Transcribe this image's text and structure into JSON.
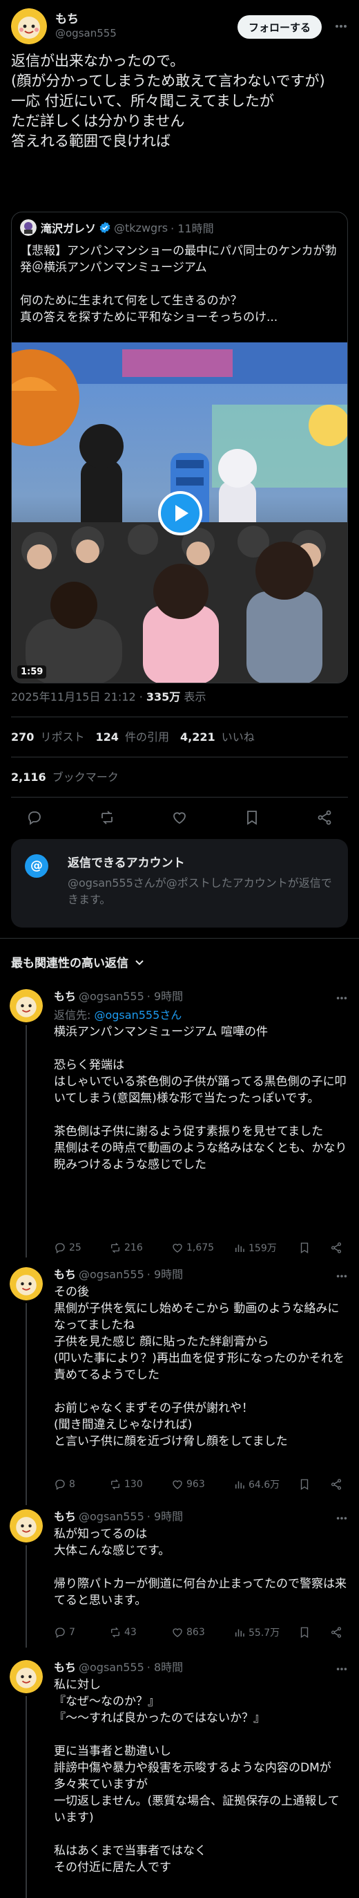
{
  "post": {
    "author_name": "もち",
    "author_handle": "@ogsan555",
    "follow_label": "フォローする",
    "text": "返信が出来なかったので。\n(顔が分かってしまうため敢えて言わないですが)\n一応 付近にいて、所々聞こえてましたが\nただ詳しくは分かりません\n答えれる範囲で良ければ",
    "quote": {
      "name": "滝沢ガレソ",
      "handle": "@tkzwgrs",
      "time": "· 11時間",
      "text": "【悲報】アンパンマンショーの最中にパパ同士のケンカが勃発＠横浜アンパンマンミュージアム\n\n何のために生まれて何をして生きるのか？\n真の答えを探すために平和なショーそっちのけ...",
      "duration": "1:59"
    },
    "timestamp": "2025年11月15日 21:12 · ",
    "views_count": "335万",
    "views_label": " 表示",
    "reposts_count": "270",
    "reposts_label": " リポスト",
    "quotes_count": "124",
    "quotes_label": " 件の引用",
    "likes_count": "4,221",
    "likes_label": " いいね",
    "bookmarks_count": "2,116",
    "bookmarks_label": " ブックマーク"
  },
  "reply_notice": {
    "title": "返信できるアカウント",
    "body": "@ogsan555さんが@ポストしたアカウントが返信できます。"
  },
  "sort_label": "最も関連性の高い返信",
  "replies": [
    {
      "name": "もち",
      "handle": "@ogsan555",
      "time": "· 9時間",
      "reply_to_prefix": "返信先: ",
      "reply_to": "@ogsan555さん",
      "text": "横浜アンパンマンミュージアム 喧嘩の件\n\n恐らく発端は\nはしゃいでいる茶色側の子供が踊ってる黒色側の子に叩いてしまう(意図無)様な形で当たったっぽいです。\n\n茶色側は子供に謝るよう促す素振りを見せてました\n黒側はその時点で動画のような絡みはなくとも、かなり睨みつけるような感じでした",
      "replies": "25",
      "reposts": "216",
      "likes": "1,675",
      "views": "159万"
    },
    {
      "name": "もち",
      "handle": "@ogsan555",
      "time": "· 9時間",
      "text": "その後\n黒側が子供を気にし始めそこから 動画のような絡みになってましたね\n子供を見た感じ 顔に貼ったた絆創膏から\n(叩いた事により？)再出血を促す形になったのかそれを責めてるようでした\n\nお前じゃなくまずその子供が謝れや！\n(聞き間違えじゃなければ)\nと言い子供に顔を近づけ脅し顔をしてました",
      "replies": "8",
      "reposts": "130",
      "likes": "963",
      "views": "64.6万"
    },
    {
      "name": "もち",
      "handle": "@ogsan555",
      "time": "· 9時間",
      "text": "私が知ってるのは\n大体こんな感じです。\n\n帰り際パトカーが側道に何台か止まってたので警察は来てると思います。",
      "replies": "7",
      "reposts": "43",
      "likes": "863",
      "views": "55.7万"
    },
    {
      "name": "もち",
      "handle": "@ogsan555",
      "time": "· 8時間",
      "text": "私に対し\n『なぜ〜なのか？』\n『〜〜すれば良かったのではないか？』\n\n更に当事者と勘違いし\n誹謗中傷や暴力や殺害を示唆するような内容のDMが多々来ていますが\n一切返しません。(悪質な場合、証拠保存の上通報しています)\n\n私はあくまで当事者ではなく\nその付近に居た人です"
    }
  ]
}
